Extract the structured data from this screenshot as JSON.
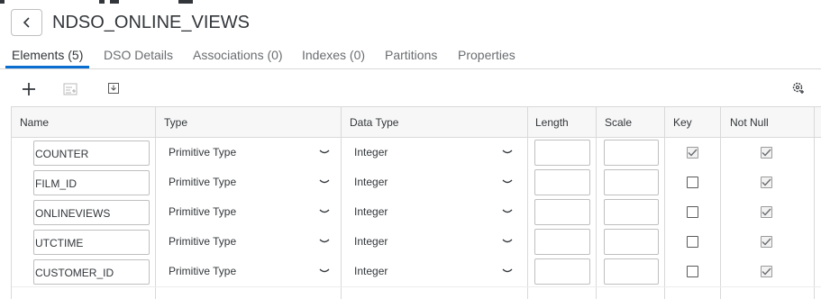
{
  "header": {
    "title": "NDSO_ONLINE_VIEWS"
  },
  "tabs": [
    {
      "label": "Elements (5)",
      "active": true
    },
    {
      "label": "DSO Details",
      "active": false
    },
    {
      "label": "Associations (0)",
      "active": false
    },
    {
      "label": "Indexes (0)",
      "active": false
    },
    {
      "label": "Partitions",
      "active": false
    },
    {
      "label": "Properties",
      "active": false
    }
  ],
  "toolbar": {
    "icons": [
      "add-icon",
      "edit-list-icon",
      "import-icon",
      "settings-icon"
    ]
  },
  "table": {
    "columns": [
      "Name",
      "Type",
      "Data Type",
      "Length",
      "Scale",
      "Key",
      "Not Null"
    ],
    "rows": [
      {
        "name": "COUNTER",
        "type": "Primitive Type",
        "data_type": "Integer",
        "length": "",
        "scale": "",
        "key": true,
        "not_null": true,
        "key_disabled": true
      },
      {
        "name": "FILM_ID",
        "type": "Primitive Type",
        "data_type": "Integer",
        "length": "",
        "scale": "",
        "key": false,
        "not_null": true,
        "key_disabled": false
      },
      {
        "name": "ONLINEVIEWS",
        "type": "Primitive Type",
        "data_type": "Integer",
        "length": "",
        "scale": "",
        "key": false,
        "not_null": true,
        "key_disabled": false
      },
      {
        "name": "UTCTIME",
        "type": "Primitive Type",
        "data_type": "Integer",
        "length": "",
        "scale": "",
        "key": false,
        "not_null": true,
        "key_disabled": false
      },
      {
        "name": "CUSTOMER_ID",
        "type": "Primitive Type",
        "data_type": "Integer",
        "length": "",
        "scale": "",
        "key": false,
        "not_null": true,
        "key_disabled": false
      }
    ]
  },
  "colors": {
    "accent": "#0a6ed1",
    "text": "#32363a",
    "border": "#d9d9d9",
    "header_bg": "#f7f7f7"
  }
}
